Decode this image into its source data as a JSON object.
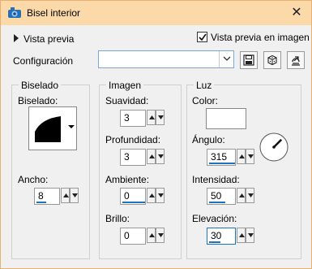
{
  "window": {
    "title": "Bisel interior",
    "close_glyph": "✕",
    "app_icon": "psp-icon"
  },
  "top": {
    "preview_toggle_label": "Vista previa",
    "preview_checkbox_label": "Vista previa en imagen",
    "preview_checked": true
  },
  "config": {
    "label": "Configuración",
    "selected_value": "",
    "tools": [
      "save-icon",
      "reset-icon",
      "presets-icon"
    ]
  },
  "biselado": {
    "group_title": "Biselado",
    "shape_label": "Biselado:",
    "ancho_label": "Ancho:",
    "ancho_value": "8"
  },
  "imagen": {
    "group_title": "Imagen",
    "suavidad_label": "Suavidad:",
    "suavidad_value": "3",
    "profundidad_label": "Profundidad:",
    "profundidad_value": "3",
    "ambiente_label": "Ambiente:",
    "ambiente_value": "0",
    "brillo_label": "Brillo:",
    "brillo_value": "0"
  },
  "luz": {
    "group_title": "Luz",
    "color_label": "Color:",
    "color_value": "#ffffff",
    "angulo_label": "Ángulo:",
    "angulo_value": "315",
    "intensidad_label": "Intensidad:",
    "intensidad_value": "50",
    "elevacion_label": "Elevación:",
    "elevacion_value": "30"
  }
}
